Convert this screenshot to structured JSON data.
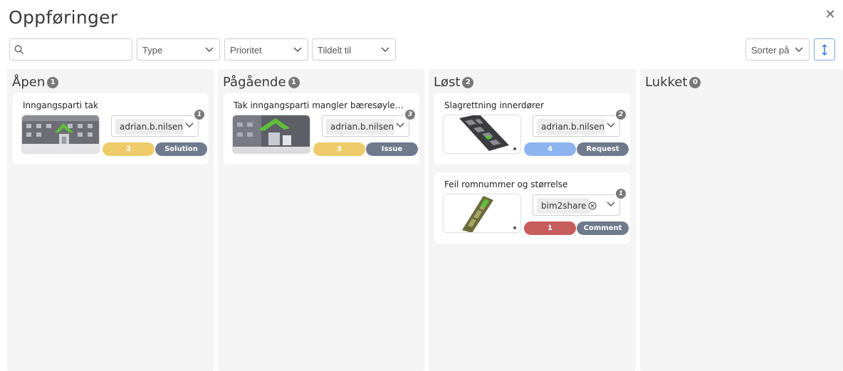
{
  "page": {
    "title": "Oppføringer"
  },
  "filters": {
    "search_placeholder": "",
    "type_label": "Type",
    "priority_label": "Prioritet",
    "assigned_label": "Tildelt til",
    "sort_label": "Sorter på"
  },
  "columns": [
    {
      "name": "Åpen",
      "count": "1",
      "cards": [
        {
          "title": "Inngangsparti tak",
          "assignee": "adrian.b.nilsen",
          "comments": "1",
          "priority": "2",
          "type": "Solution"
        }
      ]
    },
    {
      "name": "Pågående",
      "count": "1",
      "cards": [
        {
          "title": "Tak inngangsparti mangler bæresøyler y...",
          "assignee": "adrian.b.nilsen",
          "comments": "3",
          "priority": "3",
          "type": "Issue"
        }
      ]
    },
    {
      "name": "Løst",
      "count": "2",
      "cards": [
        {
          "title": "Slagrettning innerdører",
          "assignee": "adrian.b.nilsen",
          "comments": "2",
          "priority": "4",
          "type": "Request"
        },
        {
          "title": "Feil romnummer og størrelse",
          "assignee": "bim2share",
          "comments": "1",
          "priority": "1",
          "type": "Comment"
        }
      ]
    },
    {
      "name": "Lukket",
      "count": "0",
      "cards": []
    }
  ],
  "colors": {
    "priority_1": "#c75c5c",
    "priority_2": "#efcb6a",
    "priority_3": "#efcb6a",
    "priority_4": "#8db4ef",
    "type_badge": "#6f7a8c"
  }
}
